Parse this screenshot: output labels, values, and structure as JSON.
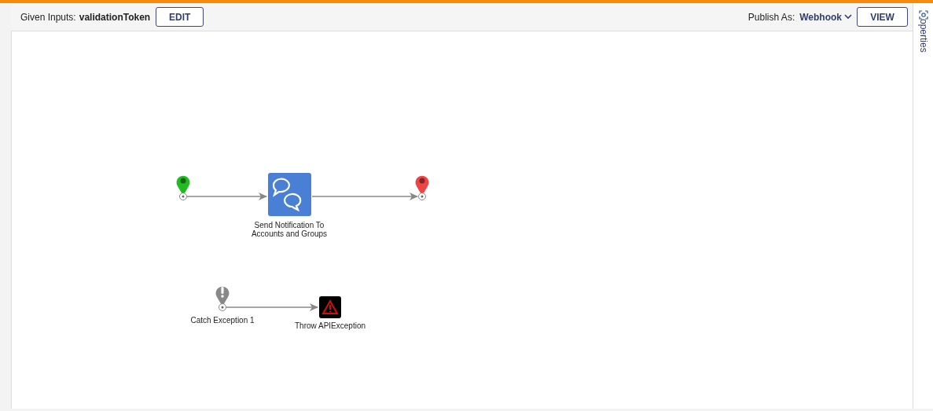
{
  "toolbar": {
    "inputs_label": "Given Inputs:",
    "inputs_value": "validationToken",
    "edit_button": "EDIT",
    "publish_label": "Publish As:",
    "publish_value": "Webhook",
    "view_button": "VIEW"
  },
  "side_panel": {
    "label": "operties"
  },
  "flow": {
    "nodes": [
      {
        "kind": "start",
        "arrow_to_next": true
      },
      {
        "kind": "action",
        "label": [
          "Send Notification To",
          "Accounts and Groups"
        ],
        "arrow_to_next": true
      },
      {
        "kind": "end",
        "arrow_to_next": false
      },
      {
        "kind": "catch",
        "label": [
          "Catch Exception 1"
        ],
        "arrow_to_next": true
      },
      {
        "kind": "throw",
        "label": [
          "Throw APIException"
        ]
      }
    ]
  }
}
